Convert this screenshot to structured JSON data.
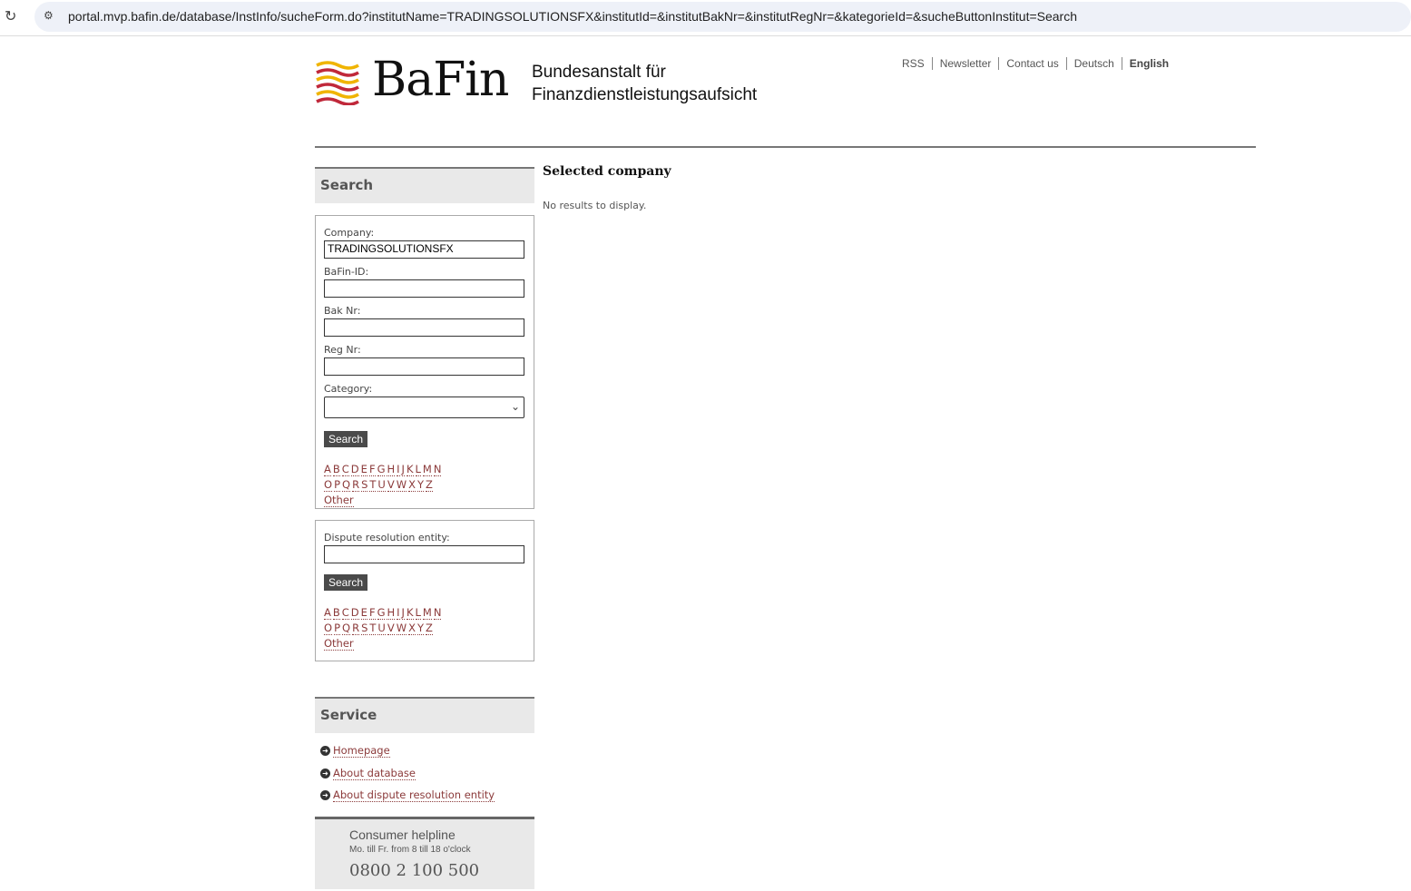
{
  "browser": {
    "url": "portal.mvp.bafin.de/database/InstInfo/sucheForm.do?institutName=TRADINGSOLUTIONSFX&institutId=&institutBakNr=&institutRegNr=&kategorieId=&sucheButtonInstitut=Search"
  },
  "header": {
    "brand": "BaFin",
    "subtitle_line1": "Bundesanstalt für",
    "subtitle_line2": "Finanzdienstleistungsaufsicht",
    "nav": [
      "RSS",
      "Newsletter",
      "Contact us",
      "Deutsch",
      "English"
    ]
  },
  "search": {
    "heading": "Search",
    "company_label": "Company:",
    "company_value": "TRADINGSOLUTIONSFX",
    "bafin_id_label": "BaFin-ID:",
    "bak_label": "Bak Nr:",
    "reg_label": "Reg Nr:",
    "category_label": "Category:",
    "search_button": "Search"
  },
  "dispute": {
    "label": "Dispute resolution entity:",
    "search_button": "Search"
  },
  "letters_row1": [
    "A",
    "B",
    "C",
    "D",
    "E",
    "F",
    "G",
    "H",
    "I",
    "J",
    "K",
    "L",
    "M",
    "N"
  ],
  "letters_row2": [
    "O",
    "P",
    "Q",
    "R",
    "S",
    "T",
    "U",
    "V",
    "W",
    "X",
    "Y",
    "Z"
  ],
  "other_label": "Other",
  "main": {
    "heading": "Selected company",
    "no_results": "No results to display."
  },
  "service": {
    "heading": "Service",
    "links": [
      "Homepage",
      "About database",
      "About dispute resolution entity"
    ]
  },
  "helpline": {
    "title": "Consumer helpline",
    "hours": "Mo. till Fr. from 8 till 18 o'clock",
    "phone": "0800 2 100 500"
  }
}
